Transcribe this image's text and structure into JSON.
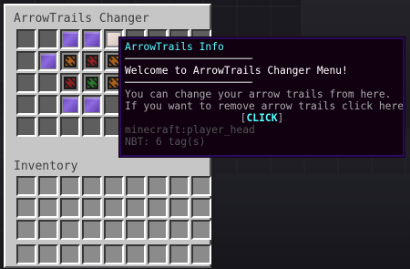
{
  "window": {
    "title": "ArrowTrails Changer",
    "inventory_title": "Inventory"
  },
  "menu_grid": [
    [
      "empty",
      "empty",
      "pane",
      "pane",
      "paper",
      "empty",
      "empty",
      "empty",
      "empty"
    ],
    [
      "empty",
      "pane",
      "head-orange",
      "head-red",
      "head-orange",
      "empty",
      "empty",
      "empty",
      "empty"
    ],
    [
      "empty",
      "empty",
      "head-red",
      "head-green",
      "head-orange",
      "empty",
      "empty",
      "empty",
      "empty"
    ],
    [
      "empty",
      "empty",
      "pane",
      "pane",
      "empty",
      "empty",
      "empty",
      "empty",
      "empty"
    ],
    [
      "empty",
      "empty",
      "empty",
      "empty",
      "empty",
      "empty",
      "empty",
      "empty",
      "empty"
    ]
  ],
  "tooltip": {
    "title": "ArrowTrails Info",
    "separator": "────────────────────────",
    "welcome": "Welcome to ArrowTrails Changer Menu!",
    "line1": "You can change your arrow trails from here.",
    "line2": "If you want to remove arrow trails click here.",
    "click_open": "[",
    "click": "CLICK",
    "click_close": "]",
    "item_id": "minecraft:player_head",
    "nbt": "NBT: 6 tag(s)"
  },
  "colors": {
    "tooltip_bg": "#100010",
    "tooltip_border": "#2a0a5a",
    "accent_aqua": "#55ffff",
    "text_gray": "#aaaaaa",
    "gui_bg": "#c6c6c6",
    "pane_purple": "#7a55cc"
  }
}
